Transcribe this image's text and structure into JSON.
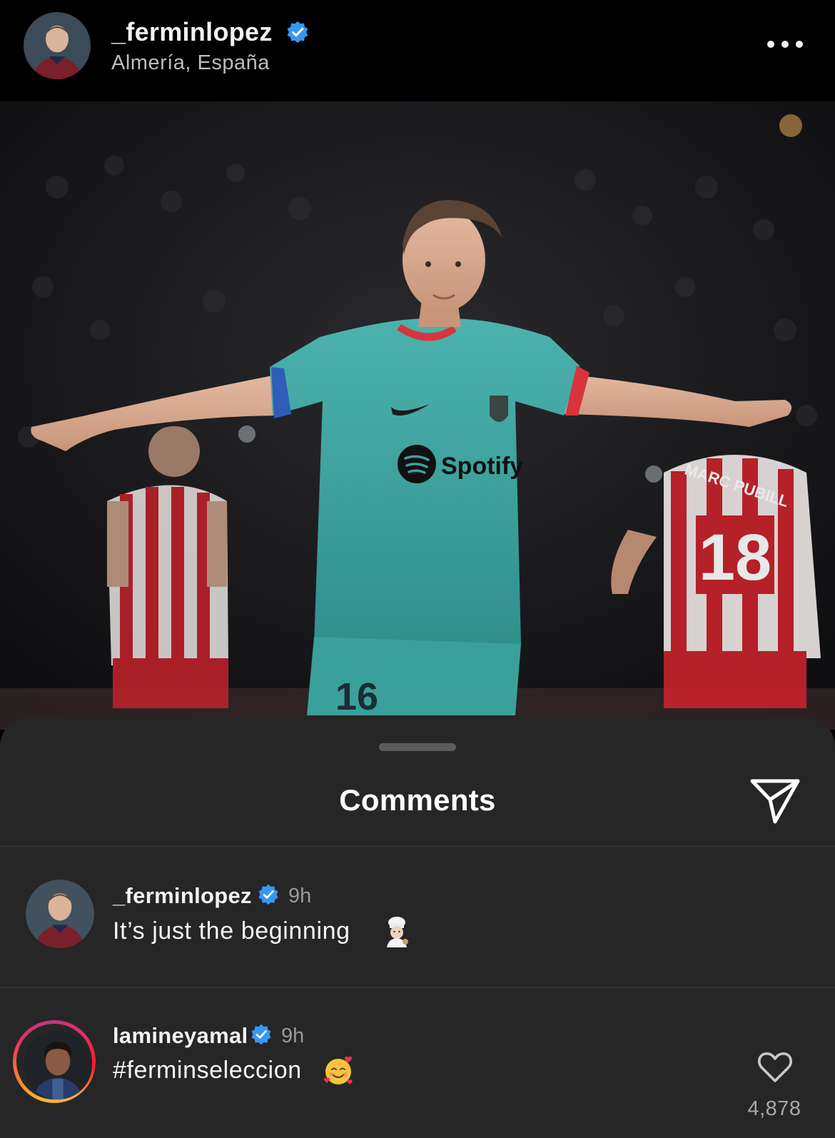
{
  "post": {
    "username": "_ferminlopez",
    "location": "Almería, España",
    "verified": true,
    "photo": {
      "jersey_sponsor": "Spotify",
      "player_number": "16",
      "opponent_number": "18",
      "opponent_name": "MARC PUBILL"
    }
  },
  "comments_sheet": {
    "title": "Comments",
    "comments": [
      {
        "username": "_ferminlopez",
        "verified": true,
        "time": "9h",
        "text": "It’s just the beginning",
        "emoji": "cook-emoji"
      },
      {
        "username": "lamineyamal",
        "verified": true,
        "time": "9h",
        "text": "#ferminseleccion",
        "emoji": "smiling-face-with-hearts-emoji",
        "like_count": "4,878",
        "has_story_ring": true
      }
    ]
  },
  "colors": {
    "background": "#000000",
    "sheet": "#262626",
    "verified_blue": "#3797f0",
    "jersey_teal": "#3fa5a3",
    "opponent_red": "#c8222b"
  }
}
